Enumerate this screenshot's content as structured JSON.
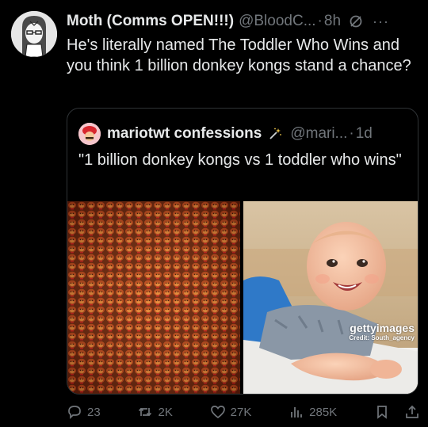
{
  "tweet": {
    "author": "Moth (Comms OPEN!!!)",
    "handle": "@BloodC...",
    "separator": "·",
    "time": "8h",
    "text": "He's literally named The Toddler Who Wins and you think 1 billion donkey kongs stand a chance?",
    "icons": {
      "avatar": "anime-girl-avatar",
      "grok": "grok-icon",
      "more": "more-icon"
    }
  },
  "quote": {
    "author": "mariotwt confessions",
    "handle": "@mari...",
    "separator": "·",
    "time": "1d",
    "text": "\"1 billion donkey kongs vs 1 toddler who wins\"",
    "icons": {
      "avatar": "mario-avatar",
      "badge": "magic-wand-icon"
    },
    "images": [
      {
        "name": "donkey-kong-crowd-image"
      },
      {
        "name": "smiling-baby-image",
        "watermark_logo": "gettyimages",
        "watermark_credit": "Credit: South_agency"
      }
    ]
  },
  "actions": {
    "replies": "23",
    "reposts": "2K",
    "likes": "27K",
    "views": "285K",
    "icons": [
      "reply-icon",
      "repost-icon",
      "like-icon",
      "views-icon",
      "bookmark-icon",
      "share-icon"
    ]
  },
  "colors": {
    "background": "#000000",
    "text": "#e7e9ea",
    "muted": "#71767b",
    "border": "#2f3336"
  }
}
